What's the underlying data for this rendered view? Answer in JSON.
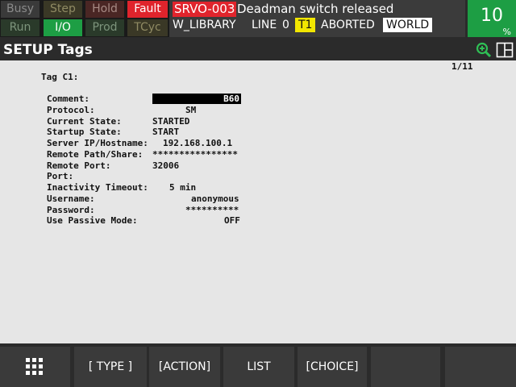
{
  "status": {
    "busy": "Busy",
    "step": "Step",
    "hold": "Hold",
    "fault": "Fault",
    "run": "Run",
    "io": "I/O",
    "prod": "Prod",
    "tcyc": "TCyc"
  },
  "alarm": {
    "code": "SRVO-003",
    "message": "Deadman switch released",
    "program": "W_LIBRARY",
    "line_label": "LINE",
    "line_number": "0",
    "mode": "T1",
    "state": "ABORTED",
    "frame": "WORLD"
  },
  "override": {
    "value": "10",
    "unit": "%"
  },
  "title": "SETUP Tags",
  "page_indicator": "1/11",
  "tag_heading": "Tag C1:",
  "fields": {
    "comment": {
      "label": "Comment:",
      "value": "B60"
    },
    "protocol": {
      "label": "Protocol:",
      "value": "SM"
    },
    "current_state": {
      "label": "Current State:",
      "value": "STARTED"
    },
    "startup_state": {
      "label": "Startup State:",
      "value": "START"
    },
    "server": {
      "label": "Server IP/Hostname:",
      "value": "192.168.100.1"
    },
    "remote_path": {
      "label": "Remote Path/Share:",
      "value": "****************"
    },
    "remote_port": {
      "label": "Remote Port:",
      "value": "32006"
    },
    "port": {
      "label": "Port:",
      "value": ""
    },
    "inactivity": {
      "label": "Inactivity Timeout:",
      "value": "5 min"
    },
    "username": {
      "label": "Username:",
      "value": "anonymous"
    },
    "password": {
      "label": "Password:",
      "value": "**********"
    },
    "passive": {
      "label": "Use Passive Mode:",
      "value": "OFF"
    }
  },
  "function_keys": [
    "[ TYPE ]",
    "[ACTION]",
    "LIST",
    "[CHOICE]",
    "",
    ""
  ],
  "icons": {
    "menu": "grid-icon",
    "zoom": "zoom-in-icon",
    "layout": "split-window-icon"
  },
  "colors": {
    "fault_red": "#e0242c",
    "io_green": "#1d9e44",
    "mode_yellow": "#f2e600"
  }
}
